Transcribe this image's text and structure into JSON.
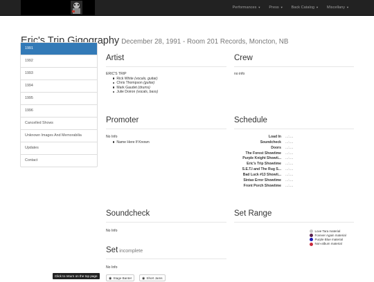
{
  "nav": {
    "items": [
      {
        "label": "Performances"
      },
      {
        "label": "Press"
      },
      {
        "label": "Back Catalog"
      },
      {
        "label": "Miscellany"
      }
    ]
  },
  "header": {
    "title": "Eric's Trip Gigography",
    "subtitle": "December 28, 1991 - Room 201 Records, Moncton, NB"
  },
  "sidebar": {
    "items": [
      {
        "label": "1991",
        "active": true
      },
      {
        "label": "1992"
      },
      {
        "label": "1993"
      },
      {
        "label": "1994"
      },
      {
        "label": "1995"
      },
      {
        "label": "1996"
      },
      {
        "label": "Cancelled Shows"
      },
      {
        "label": "Unknown Images And Memorabilia"
      },
      {
        "label": "Updates"
      },
      {
        "label": "Contact"
      }
    ]
  },
  "artist": {
    "heading": "Artist",
    "band": "ERIC'S TRIP",
    "members": [
      {
        "name": "Rick White",
        "role": "(vocals, guitar)"
      },
      {
        "name": "Chris Thompson",
        "role": "(guitar)"
      },
      {
        "name": "Mark Gaudet",
        "role": "(drums)"
      },
      {
        "name": "Julie Doiron",
        "role": "(vocals, bass)"
      }
    ]
  },
  "crew": {
    "heading": "Crew",
    "text": "no info"
  },
  "promoter": {
    "heading": "Promoter",
    "text": "No Info",
    "item": "Name Here If Known"
  },
  "schedule": {
    "heading": "Schedule",
    "rows": [
      {
        "name": "Load In",
        "time": "...:...."
      },
      {
        "name": "Soundcheck",
        "time": "...:...."
      },
      {
        "name": "Doors",
        "time": "...:...."
      },
      {
        "name": "The Forest Showtime",
        "time": "...:...."
      },
      {
        "name": "Purple Knight Showti...",
        "time": "...:...."
      },
      {
        "name": "Eric's Trip Showtime",
        "time": "...:...."
      },
      {
        "name": "S.E.T.I and The Rug S...",
        "time": "...:...."
      },
      {
        "name": "Bad Luck #13 Showti...",
        "time": "...:...."
      },
      {
        "name": "Sintax Error Showtime",
        "time": "...:...."
      },
      {
        "name": "Front Porch Showtime",
        "time": "...:...."
      }
    ]
  },
  "soundcheck": {
    "heading": "Soundcheck",
    "text": "No Info"
  },
  "setrange": {
    "heading": "Set Range",
    "legend": [
      {
        "label": "Love Tara material",
        "color": "#c8c8c8"
      },
      {
        "label": "Forever Again material",
        "color": "#5b1f4c"
      },
      {
        "label": "Purple Blue material",
        "color": "#1d1db8"
      },
      {
        "label": "Non-album material",
        "color": "#c8283c"
      }
    ]
  },
  "set": {
    "heading": "Set",
    "status": "incomplete",
    "text": "No Info"
  },
  "footer": {
    "scroll_top": "Click to return on the top page",
    "stage_banter": "Stage Banter",
    "short_jams": "Short Jams"
  }
}
